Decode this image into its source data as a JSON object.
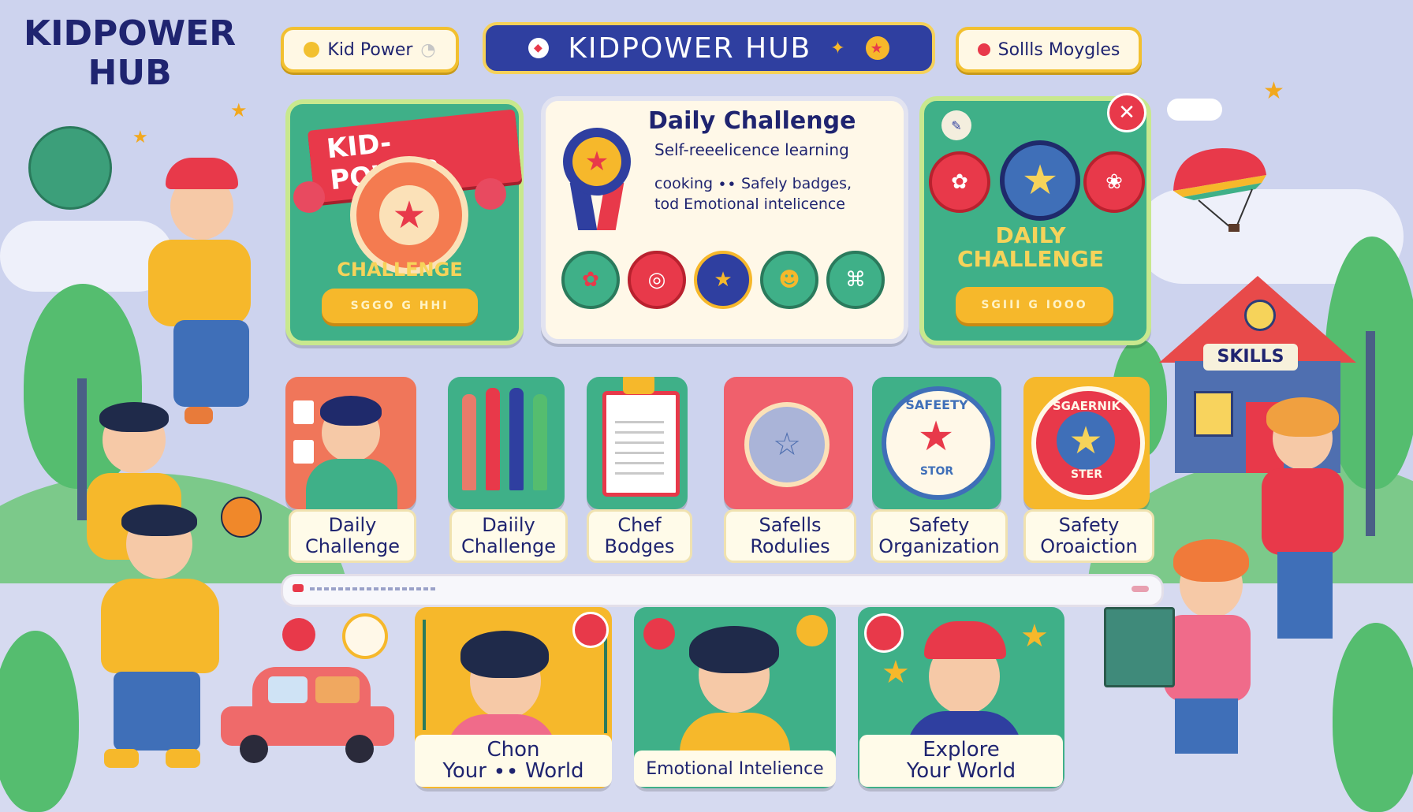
{
  "app": {
    "logo_line1": "KIDPOWER",
    "logo_line2": "HUB"
  },
  "header": {
    "left_pill": "Kid Power",
    "center_title": "KIDPOWER HUB",
    "right_pill": "Sollls Moygles"
  },
  "cards": {
    "left": {
      "banner": "KID-POWER",
      "label": "CHALLENGE",
      "button": "SGGO G HHI"
    },
    "center": {
      "title": "Daily Challenge",
      "line1": "Self-reeelicence learning",
      "line2": "cooking ∙∙ Safely badges,",
      "line3": "tod Emotional intelicence"
    },
    "right": {
      "title_line1": "DAILY",
      "title_line2": "CHALLENGE",
      "button": "SGIII G IOOO"
    }
  },
  "tiles": [
    {
      "line1": "Daily",
      "line2": "Challenge"
    },
    {
      "line1": "Daiily",
      "line2": "Challenge"
    },
    {
      "line1": "Chef",
      "line2": "Bodges"
    },
    {
      "line1": "Safells",
      "line2": "Rodulies"
    },
    {
      "line1": "Safety",
      "line2": "Organization",
      "badge_top": "SAFEETY",
      "badge_bottom": "STOR"
    },
    {
      "line1": "Safety",
      "line2": "Oroaiction",
      "badge_top": "SGAERNIK",
      "badge_bottom": "STER"
    }
  ],
  "house": {
    "sign": "SKILLS"
  },
  "bottom": [
    {
      "line1": "Chon",
      "line2": "Your ∙∙ World"
    },
    {
      "line1": "Emotional Intelience",
      "line2": ""
    },
    {
      "line1": "Explore",
      "line2": "Your World"
    }
  ],
  "colors": {
    "background": "#cdd3ee",
    "navy": "#1f2470",
    "green": "#3fb088",
    "yellow": "#f6b82b",
    "red": "#e8394a"
  }
}
